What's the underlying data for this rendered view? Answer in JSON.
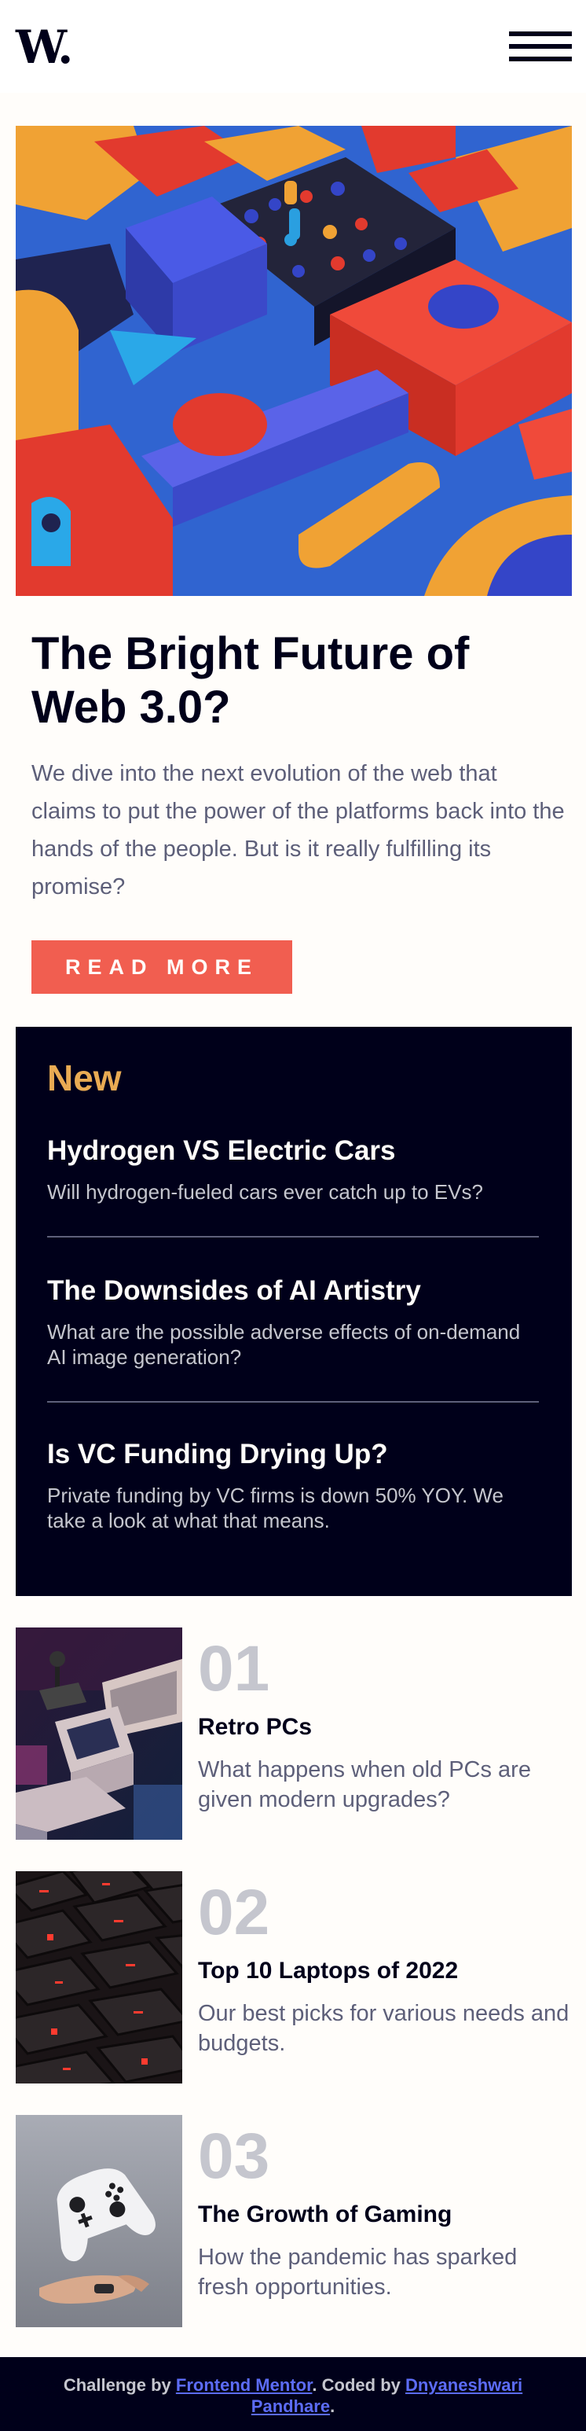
{
  "header": {
    "logo": "W.",
    "menu_icon": "hamburger-menu-icon"
  },
  "hero": {
    "image_icon": "abstract-3d-blocks-image",
    "title": "The Bright Future of Web 3.0?",
    "description": "We dive into the next evolution of the web that claims to put the power of the platforms back into the hands of the people. But is it really fulfilling its promise?",
    "button_label": "READ MORE"
  },
  "new_section": {
    "heading": "New",
    "items": [
      {
        "title": "Hydrogen VS Electric Cars",
        "description": "Will hydrogen-fueled cars ever catch up to EVs?"
      },
      {
        "title": "The Downsides of AI Artistry",
        "description": "What are the possible adverse effects of on-demand AI image generation?"
      },
      {
        "title": "Is VC Funding Drying Up?",
        "description": "Private funding by VC firms is down 50% YOY. We take a look at what that means."
      }
    ]
  },
  "articles": [
    {
      "number": "01",
      "title": "Retro PCs",
      "description": "What happens when old PCs are given modern upgrades?",
      "image_icon": "retro-pc-image"
    },
    {
      "number": "02",
      "title": "Top 10 Laptops of 2022",
      "description": "Our best picks for various needs and budgets.",
      "image_icon": "laptop-keyboard-image"
    },
    {
      "number": "03",
      "title": "The Growth of Gaming",
      "description": "How the pandemic has sparked fresh opportunities.",
      "image_icon": "game-controller-image"
    }
  ],
  "footer": {
    "prefix": "Challenge by ",
    "challenge_link": "Frontend Mentor",
    "middle": ". Coded by ",
    "author_link": "Dnyaneshwari Pandhare",
    "suffix": "."
  },
  "colors": {
    "background": "#fffdfa",
    "dark_navy": "#00001a",
    "soft_red": "#f15e50",
    "soft_orange": "#e9ab53",
    "grayish_blue": "#5d5f79",
    "grayish_light": "#c5c6ce"
  }
}
